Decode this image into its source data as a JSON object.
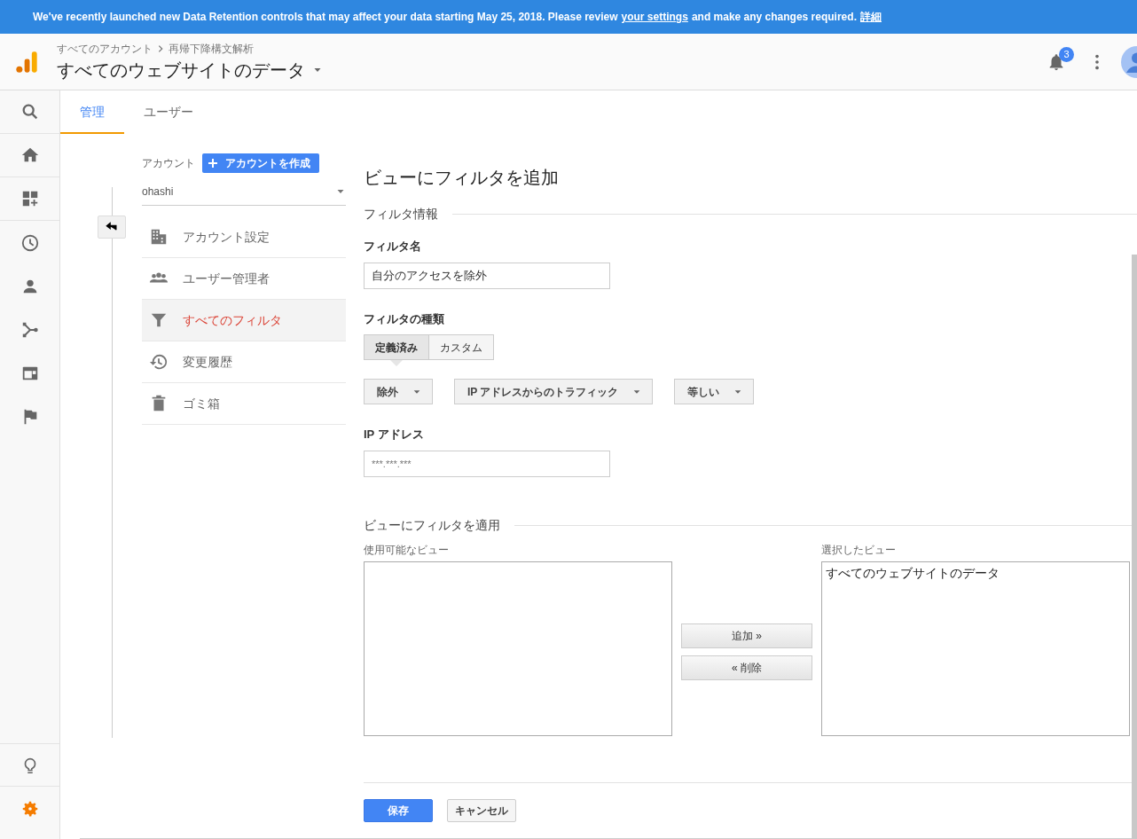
{
  "banner": {
    "text": "We've recently launched new Data Retention controls that may affect your data starting May 25, 2018. Please review",
    "link": "your settings",
    "text_after": "and make any changes required.",
    "details_link": "詳細"
  },
  "header": {
    "breadcrumb": [
      "すべてのアカウント",
      "再帰下降構文解析"
    ],
    "title": "すべてのウェブサイトのデータ",
    "notification_count": "3"
  },
  "rail": {
    "top": [
      {
        "kind": "search",
        "selected": false
      },
      {
        "kind": "home",
        "selected": false
      },
      {
        "kind": "dashboard",
        "selected": false
      }
    ],
    "middle": [
      {
        "kind": "clock",
        "selected": false
      },
      {
        "kind": "person",
        "selected": false
      },
      {
        "kind": "branch",
        "selected": false
      },
      {
        "kind": "window",
        "selected": false
      },
      {
        "kind": "flag",
        "selected": false
      }
    ],
    "bottom": [
      {
        "kind": "bulb",
        "selected": false
      },
      {
        "kind": "gear",
        "selected": true
      }
    ]
  },
  "tabs": [
    {
      "label": "管理",
      "selected": true
    },
    {
      "label": "ユーザー",
      "selected": false
    }
  ],
  "account": {
    "label": "アカウント",
    "create_button": "アカウントを作成",
    "selected_account": "ohashi"
  },
  "account_menu": [
    {
      "kind": "building",
      "label": "アカウント設定",
      "selected": false
    },
    {
      "kind": "users",
      "label": "ユーザー管理者",
      "selected": false
    },
    {
      "kind": "filter",
      "label": "すべてのフィルタ",
      "selected": true
    },
    {
      "kind": "history",
      "label": "変更履歴",
      "selected": false
    },
    {
      "kind": "trash",
      "label": "ゴミ箱",
      "selected": false
    }
  ],
  "form": {
    "title": "ビューにフィルタを追加",
    "section_info": "フィルタ情報",
    "name_label": "フィルタ名",
    "name_value": "自分のアクセスを除外",
    "type_label": "フィルタの種類",
    "type_options": [
      {
        "label": "定義済み",
        "selected": true
      },
      {
        "label": "カスタム",
        "selected": false
      }
    ],
    "dropdowns": [
      "除外",
      "IP アドレスからのトラフィック",
      "等しい"
    ],
    "ip_label": "IP アドレス",
    "ip_value": "***.***.***",
    "section_apply": "ビューにフィルタを適用",
    "available_label": "使用可能なビュー",
    "selected_label": "選択したビュー",
    "selected_views": [
      "すべてのウェブサイトのデータ"
    ],
    "add_button": "追加 »",
    "remove_button": "« 削除",
    "save_button": "保存",
    "cancel_button": "キャンセル"
  }
}
